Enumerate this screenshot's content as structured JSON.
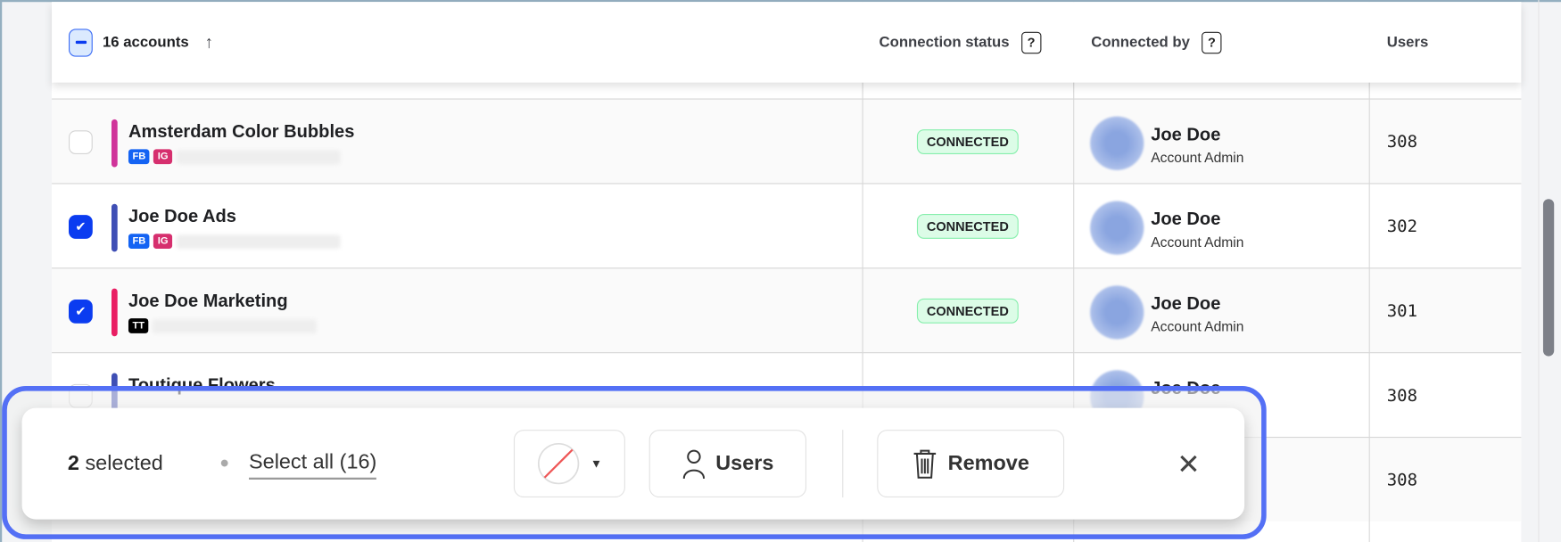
{
  "header": {
    "count_label": "16 accounts",
    "sort_icon": "arrow-up-icon",
    "connection_status": "Connection status",
    "connected_by": "Connected by",
    "users": "Users",
    "help_glyph": "?"
  },
  "rows": [
    {
      "name": "Amsterdam Color Bubbles",
      "color": "#d0349a",
      "tags": [
        "FB",
        "IG"
      ],
      "checked": false,
      "status": "CONNECTED",
      "person": "Joe Doe",
      "role": "Account Admin",
      "users": "308"
    },
    {
      "name": "Joe Doe Ads",
      "color": "#3f4fb5",
      "tags": [
        "FB",
        "IG"
      ],
      "checked": true,
      "status": "CONNECTED",
      "person": "Joe Doe",
      "role": "Account Admin",
      "users": "302"
    },
    {
      "name": "Joe Doe Marketing",
      "color": "#e91e63",
      "tags": [
        "TT"
      ],
      "checked": true,
      "status": "CONNECTED",
      "person": "Joe Doe",
      "role": "Account Admin",
      "users": "301"
    },
    {
      "name": "Toutique Flowers",
      "color": "#3f4fb5",
      "tags": [],
      "checked": false,
      "status": "",
      "person": "Joe Doe",
      "role": "",
      "users": "308"
    },
    {
      "name": "",
      "color": "#e91e63",
      "tags": [],
      "checked": false,
      "status": "",
      "person": "",
      "role": "",
      "users": "308"
    }
  ],
  "toolbar": {
    "selected_count": "2",
    "selected_label": "selected",
    "select_all": "Select all (16)",
    "users_button": "Users",
    "remove_button": "Remove",
    "close_glyph": "✕"
  },
  "colors": {
    "accent": "#0b3cf0",
    "highlight_outline": "#5470f5",
    "fb": "#1463f3",
    "ig": "#d62f6e",
    "tt": "#000000"
  }
}
